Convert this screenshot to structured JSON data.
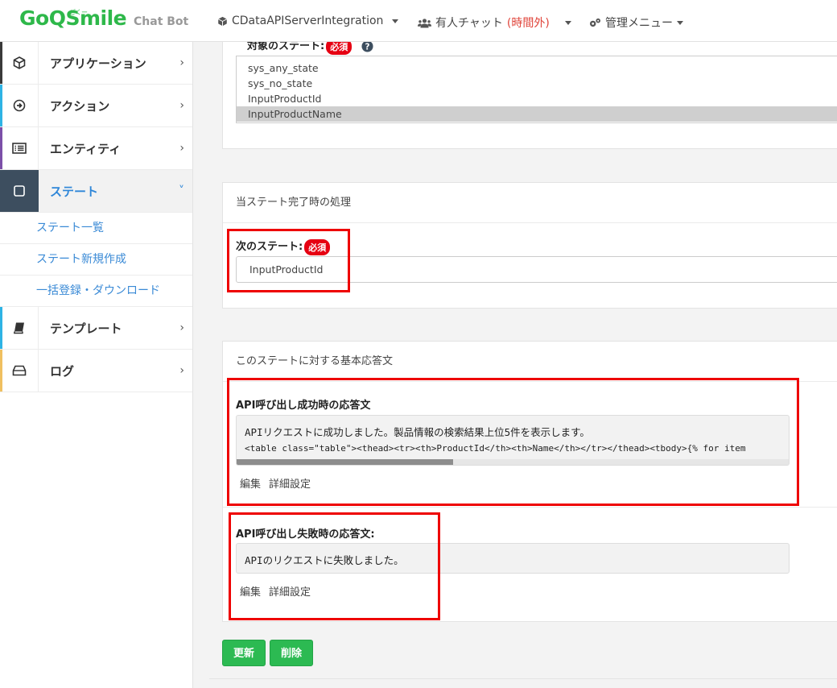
{
  "header": {
    "logo": "GoQSmile",
    "logo_kana": "ごくー",
    "subtitle": "Chat Bot",
    "nav_app": "CDataAPIServerIntegration",
    "nav_chat": "有人チャット",
    "nav_chat_status": "(時間外)",
    "nav_admin": "管理メニュー"
  },
  "sidebar": {
    "items": [
      {
        "label": "アプリケーション",
        "icon": "cube-icon",
        "color": "#3a3a3a"
      },
      {
        "label": "アクション",
        "icon": "arrow-circle-icon",
        "color": "#2eb3e5"
      },
      {
        "label": "エンティティ",
        "icon": "list-icon",
        "color": "#7c4fa8"
      },
      {
        "label": "ステート",
        "icon": "square-icon",
        "color": "#3d4e5f"
      },
      {
        "label": "テンプレート",
        "icon": "book-icon",
        "color": "#2eb3e5"
      },
      {
        "label": "ログ",
        "icon": "inbox-icon",
        "color": "#f0c060"
      }
    ],
    "sub_items": [
      "ステート一覧",
      "ステート新規作成",
      "一括登録・ダウンロード"
    ]
  },
  "target_states": {
    "label": "対象のステート:",
    "required": "必須",
    "options": [
      "sys_any_state",
      "sys_no_state",
      "InputProductId",
      "InputProductName"
    ],
    "selected": "InputProductName"
  },
  "completion": {
    "heading": "当ステート完了時の処理",
    "next_state_label": "次のステート:",
    "required": "必須",
    "next_state_value": "InputProductId"
  },
  "responses": {
    "heading": "このステートに対する基本応答文",
    "success_label": "API呼び出し成功時の応答文",
    "success_line1": "APIリクエストに成功しました。製品情報の検索結果上位5件を表示します。",
    "success_line2": "<table class=\"table\"><thead><tr><th>ProductId</th><th>Name</th></tr></thead><tbody>{% for item",
    "failure_label": "API呼び出し失敗時の応答文:",
    "failure_text": "APIのリクエストに失敗しました。",
    "edit_link": "編集",
    "detail_link": "詳細設定"
  },
  "buttons": {
    "update": "更新",
    "delete": "削除"
  },
  "colors": {
    "brand_green": "#2eb84a",
    "highlight_red": "#e00000",
    "link_blue": "#3a8ad6"
  }
}
